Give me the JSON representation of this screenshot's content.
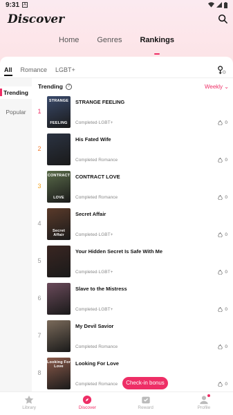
{
  "status_bar": {
    "time": "9:31",
    "notif_label": "A"
  },
  "header": {
    "title": "Discover"
  },
  "main_tabs": [
    {
      "label": "Home",
      "active": false
    },
    {
      "label": "Genres",
      "active": false
    },
    {
      "label": "Rankings",
      "active": true
    }
  ],
  "sub_tabs": [
    {
      "label": "All",
      "active": true
    },
    {
      "label": "Romance",
      "active": false
    },
    {
      "label": "LGBT+",
      "active": false
    }
  ],
  "sidebar": [
    {
      "label": "Trending",
      "active": true
    },
    {
      "label": "Popular",
      "active": false
    }
  ],
  "list_header": {
    "label": "Trending",
    "help": "?",
    "period": "Weekly"
  },
  "books": [
    {
      "rank": "1",
      "title": "STRANGE FEELING",
      "meta": "Completed·LGBT+",
      "likes": "0",
      "cover_text": "STRANGE",
      "cover_text2": "FEELING",
      "cover_color": "#3a4a6b"
    },
    {
      "rank": "2",
      "title": "His Fated Wife",
      "meta": "Completed Romance",
      "likes": "0",
      "cover_text": "",
      "cover_text2": "",
      "cover_color": "#2b3342"
    },
    {
      "rank": "3",
      "title": "CONTRACT LOVE",
      "meta": "Completed Romance",
      "likes": "0",
      "cover_text": "CONTRACT",
      "cover_text2": "LOVE",
      "cover_color": "#5a6b4a"
    },
    {
      "rank": "4",
      "title": "Secret Affair",
      "meta": "Completed·LGBT+",
      "likes": "0",
      "cover_text": "",
      "cover_text2": "Secret Affair",
      "cover_color": "#5a3a2a"
    },
    {
      "rank": "5",
      "title": "Your Hidden Secret Is Safe With Me",
      "meta": "Completed·LGBT+",
      "likes": "0",
      "cover_text": "",
      "cover_text2": "",
      "cover_color": "#3a2622"
    },
    {
      "rank": "6",
      "title": "Slave to the Mistress",
      "meta": "Completed·LGBT+",
      "likes": "0",
      "cover_text": "",
      "cover_text2": "",
      "cover_color": "#6a4a5a"
    },
    {
      "rank": "7",
      "title": "My Devil Savior",
      "meta": "Completed Romance",
      "likes": "0",
      "cover_text": "",
      "cover_text2": "",
      "cover_color": "#7a6a5a"
    },
    {
      "rank": "8",
      "title": "Looking For Love",
      "meta": "Completed Romance",
      "likes": "0",
      "cover_text": "Looking For Love",
      "cover_text2": "",
      "cover_color": "#8a5a4a"
    }
  ],
  "bonus": {
    "label": "Check-in bonus"
  },
  "bottom_nav": [
    {
      "label": "Library",
      "icon": "star-icon",
      "active": false
    },
    {
      "label": "Discover",
      "icon": "compass-icon",
      "active": true
    },
    {
      "label": "Reward",
      "icon": "gift-icon",
      "active": false
    },
    {
      "label": "Profile",
      "icon": "person-icon",
      "active": false
    }
  ],
  "colors": {
    "accent": "#ee2e66"
  }
}
